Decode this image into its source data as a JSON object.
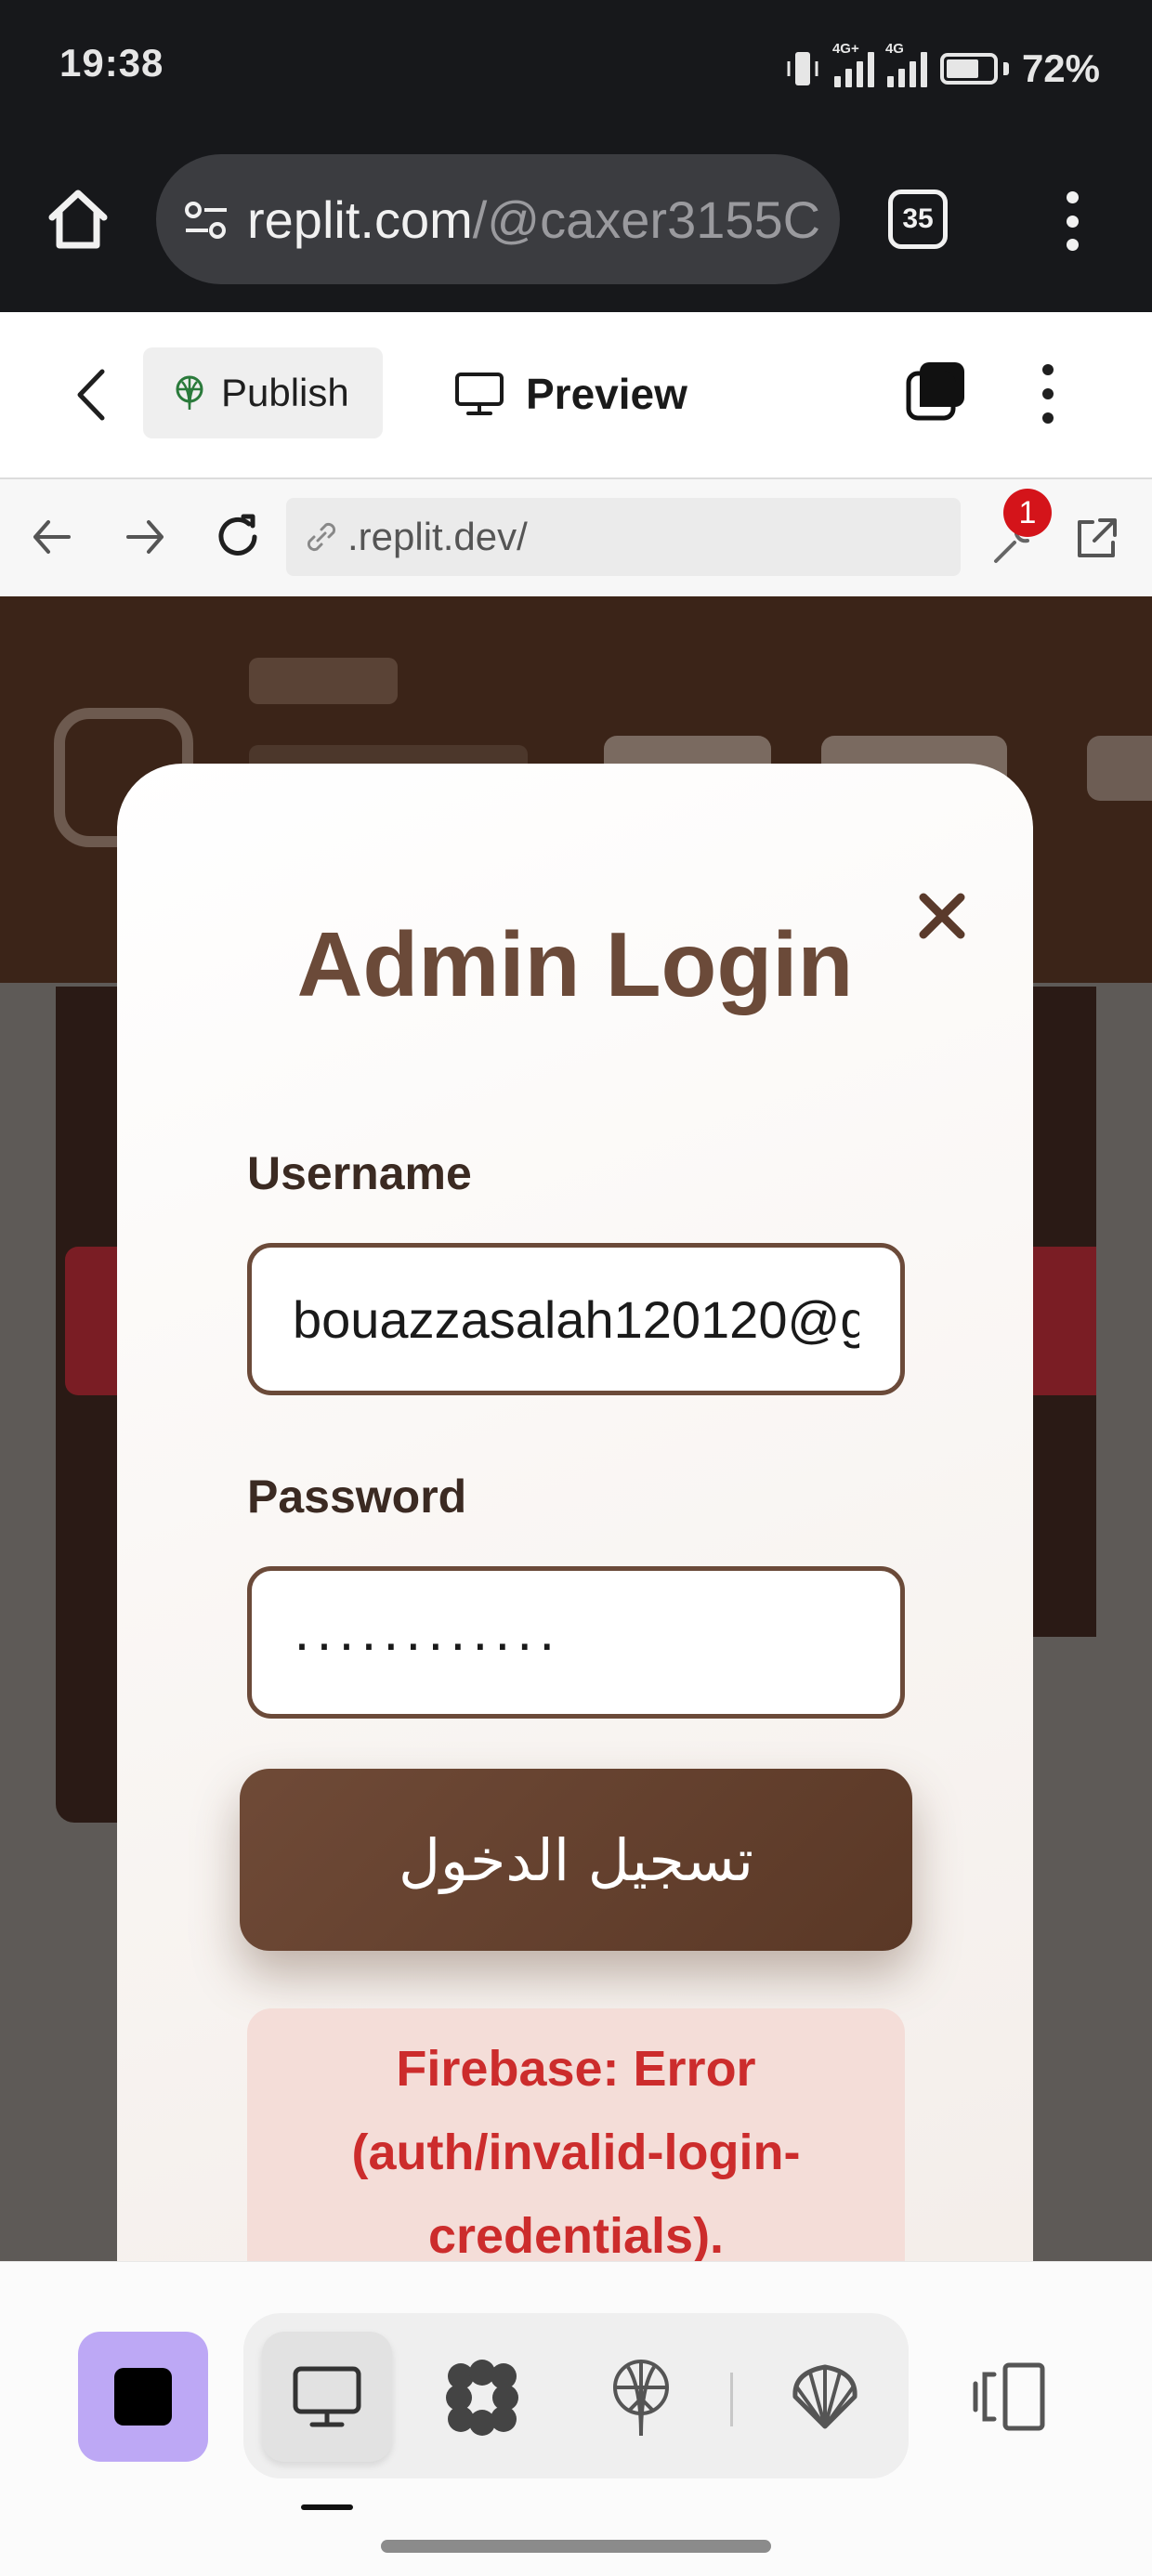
{
  "status_bar": {
    "time": "19:38",
    "network_1": "4G+",
    "network_2": "4G",
    "battery": "72%"
  },
  "browser": {
    "url": "replit.com/@caxer3155C",
    "url_host": "replit.com",
    "url_path": "/@caxer3155C",
    "tab_count": "35"
  },
  "replit_header": {
    "publish_label": "Publish",
    "preview_label": "Preview"
  },
  "webview_nav": {
    "url": ".replit.dev/",
    "notifications": "1"
  },
  "login_modal": {
    "title": "Admin Login",
    "username_label": "Username",
    "username_value": "bouazzasalah120120@g",
    "password_label": "Password",
    "password_value": "············",
    "submit_label": "تسجيل الدخول",
    "error_message": "Firebase: Error (auth/invalid-login-credentials)."
  },
  "bottom_toolbar": {
    "active_view": "preview"
  },
  "colors": {
    "brand_brown": "#6b4a39",
    "error_red": "#cc2c2c",
    "error_bg": "#f4ddd8",
    "stop_button": "#bda8f5",
    "badge_red": "#d4141a"
  },
  "icons": [
    "home-icon",
    "site-settings-icon",
    "tab-switcher-icon",
    "more-vert-icon",
    "back-icon",
    "publish-icon",
    "monitor-icon",
    "stacked-windows-icon",
    "arrow-left-icon",
    "arrow-right-icon",
    "reload-icon",
    "link-icon",
    "wrench-icon",
    "external-link-icon",
    "close-icon",
    "stop-icon",
    "flower-icon",
    "network-icon",
    "shell-icon",
    "panel-toggle-icon"
  ]
}
